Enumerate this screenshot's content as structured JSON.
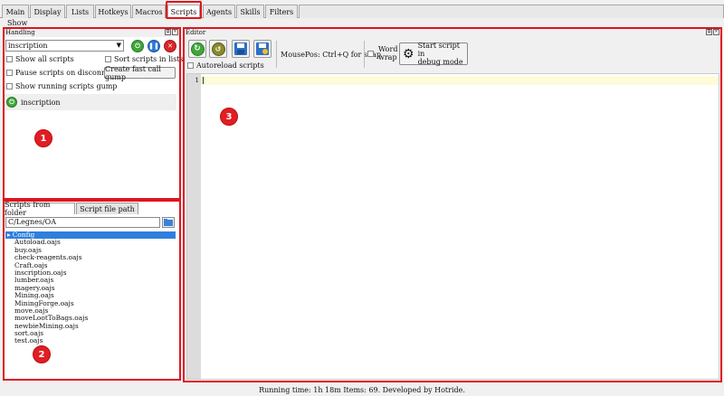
{
  "tabs": [
    "Main",
    "Display",
    "Lists",
    "Hotkeys",
    "Macros",
    "Scripts",
    "Agents",
    "Skills",
    "Filters"
  ],
  "active_tab": "Scripts",
  "menu": {
    "show": "Show"
  },
  "handling": {
    "title": "Handling",
    "combo_value": "inscription",
    "show_all": "Show all scripts",
    "sort_scripts": "Sort scripts in lists",
    "pause_on_disconnect": "Pause scripts on disconnect",
    "create_fast_call": "Create fast call gump",
    "show_running_gump": "Show running scripts gump",
    "running_script": "inscription",
    "badge": "1"
  },
  "scripts": {
    "tab_folder": "Scripts from folder",
    "tab_path": "Script file path",
    "path": "C/Legnes/OA",
    "files": [
      "Config",
      "Autoload.oajs",
      "buy.oajs",
      "check-reagents.oajs",
      "Craft.oajs",
      "inscription.oajs",
      "lumber.oajs",
      "magery.oajs",
      "Mining.oajs",
      "MiningForge.oajs",
      "move.oajs",
      "moveLootToBags.oajs",
      "newbieMining.oajs",
      "sort.oajs",
      "test.oajs"
    ],
    "badge": "2"
  },
  "editor": {
    "title": "Editor",
    "autoreload": "Autoreload scripts",
    "mousepos": "MousePos: Ctrl+Q for snap",
    "word_wrap_1": "Word",
    "word_wrap_2": "wrap",
    "debug_1": "Start script in",
    "debug_2": "debug mode",
    "line_number": "1",
    "badge": "3"
  },
  "status": "Running time: 1h 18m Items: 69. Developed by Hotride.",
  "colors": {
    "highlight": "#e0141e",
    "selection": "#2f7fdc",
    "badge": "#e01e24"
  }
}
